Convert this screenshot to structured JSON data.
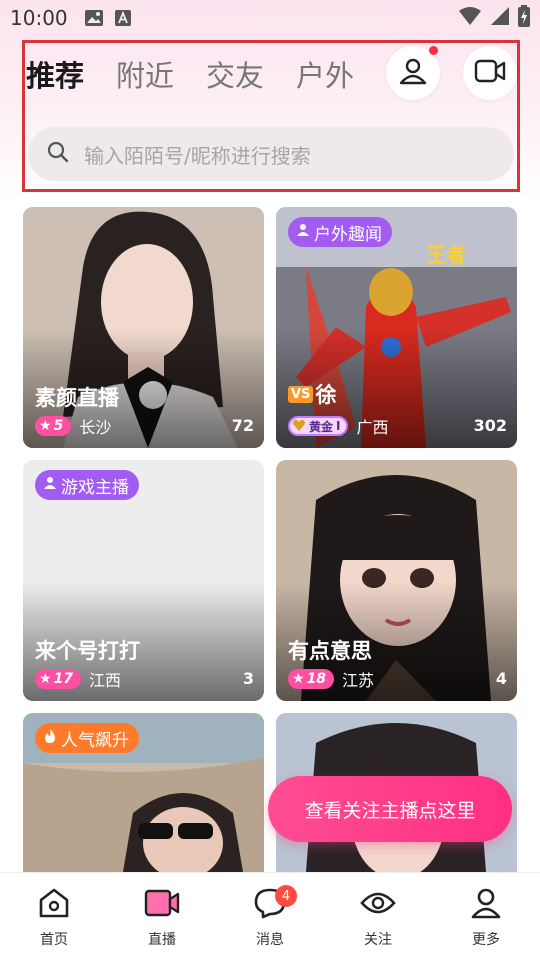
{
  "status_bar": {
    "time": "10:00"
  },
  "tabs": [
    {
      "label": "推荐",
      "active": true
    },
    {
      "label": "附近",
      "active": false
    },
    {
      "label": "交友",
      "active": false
    },
    {
      "label": "户外",
      "active": false
    }
  ],
  "search": {
    "placeholder": "输入陌陌号/昵称进行搜索"
  },
  "cards": [
    {
      "title": "素颜直播",
      "level": "5",
      "location": "长沙",
      "count": "72",
      "badge": ""
    },
    {
      "title": "徐",
      "rank": "黄金",
      "location": "广西",
      "count": "302",
      "badge": "户外趣闻"
    },
    {
      "title": "来个号打打",
      "level": "17",
      "location": "江西",
      "count": "3",
      "badge": "游戏主播"
    },
    {
      "title": "有点意思",
      "level": "18",
      "location": "江苏",
      "count": "4",
      "badge": ""
    },
    {
      "badge": "人气飙升"
    }
  ],
  "floating_button": "查看关注主播点这里",
  "bottom_nav": [
    {
      "label": "首页",
      "icon": "home-icon"
    },
    {
      "label": "直播",
      "icon": "live-video-icon",
      "active": true
    },
    {
      "label": "消息",
      "icon": "message-icon",
      "badge": "4"
    },
    {
      "label": "关注",
      "icon": "eye-icon"
    },
    {
      "label": "更多",
      "icon": "person-icon"
    }
  ],
  "colors": {
    "accent": "#ff3f8c",
    "badge_purple": "#a25cf2",
    "badge_orange": "#ff7a2b",
    "header_outline": "#d9343a"
  }
}
